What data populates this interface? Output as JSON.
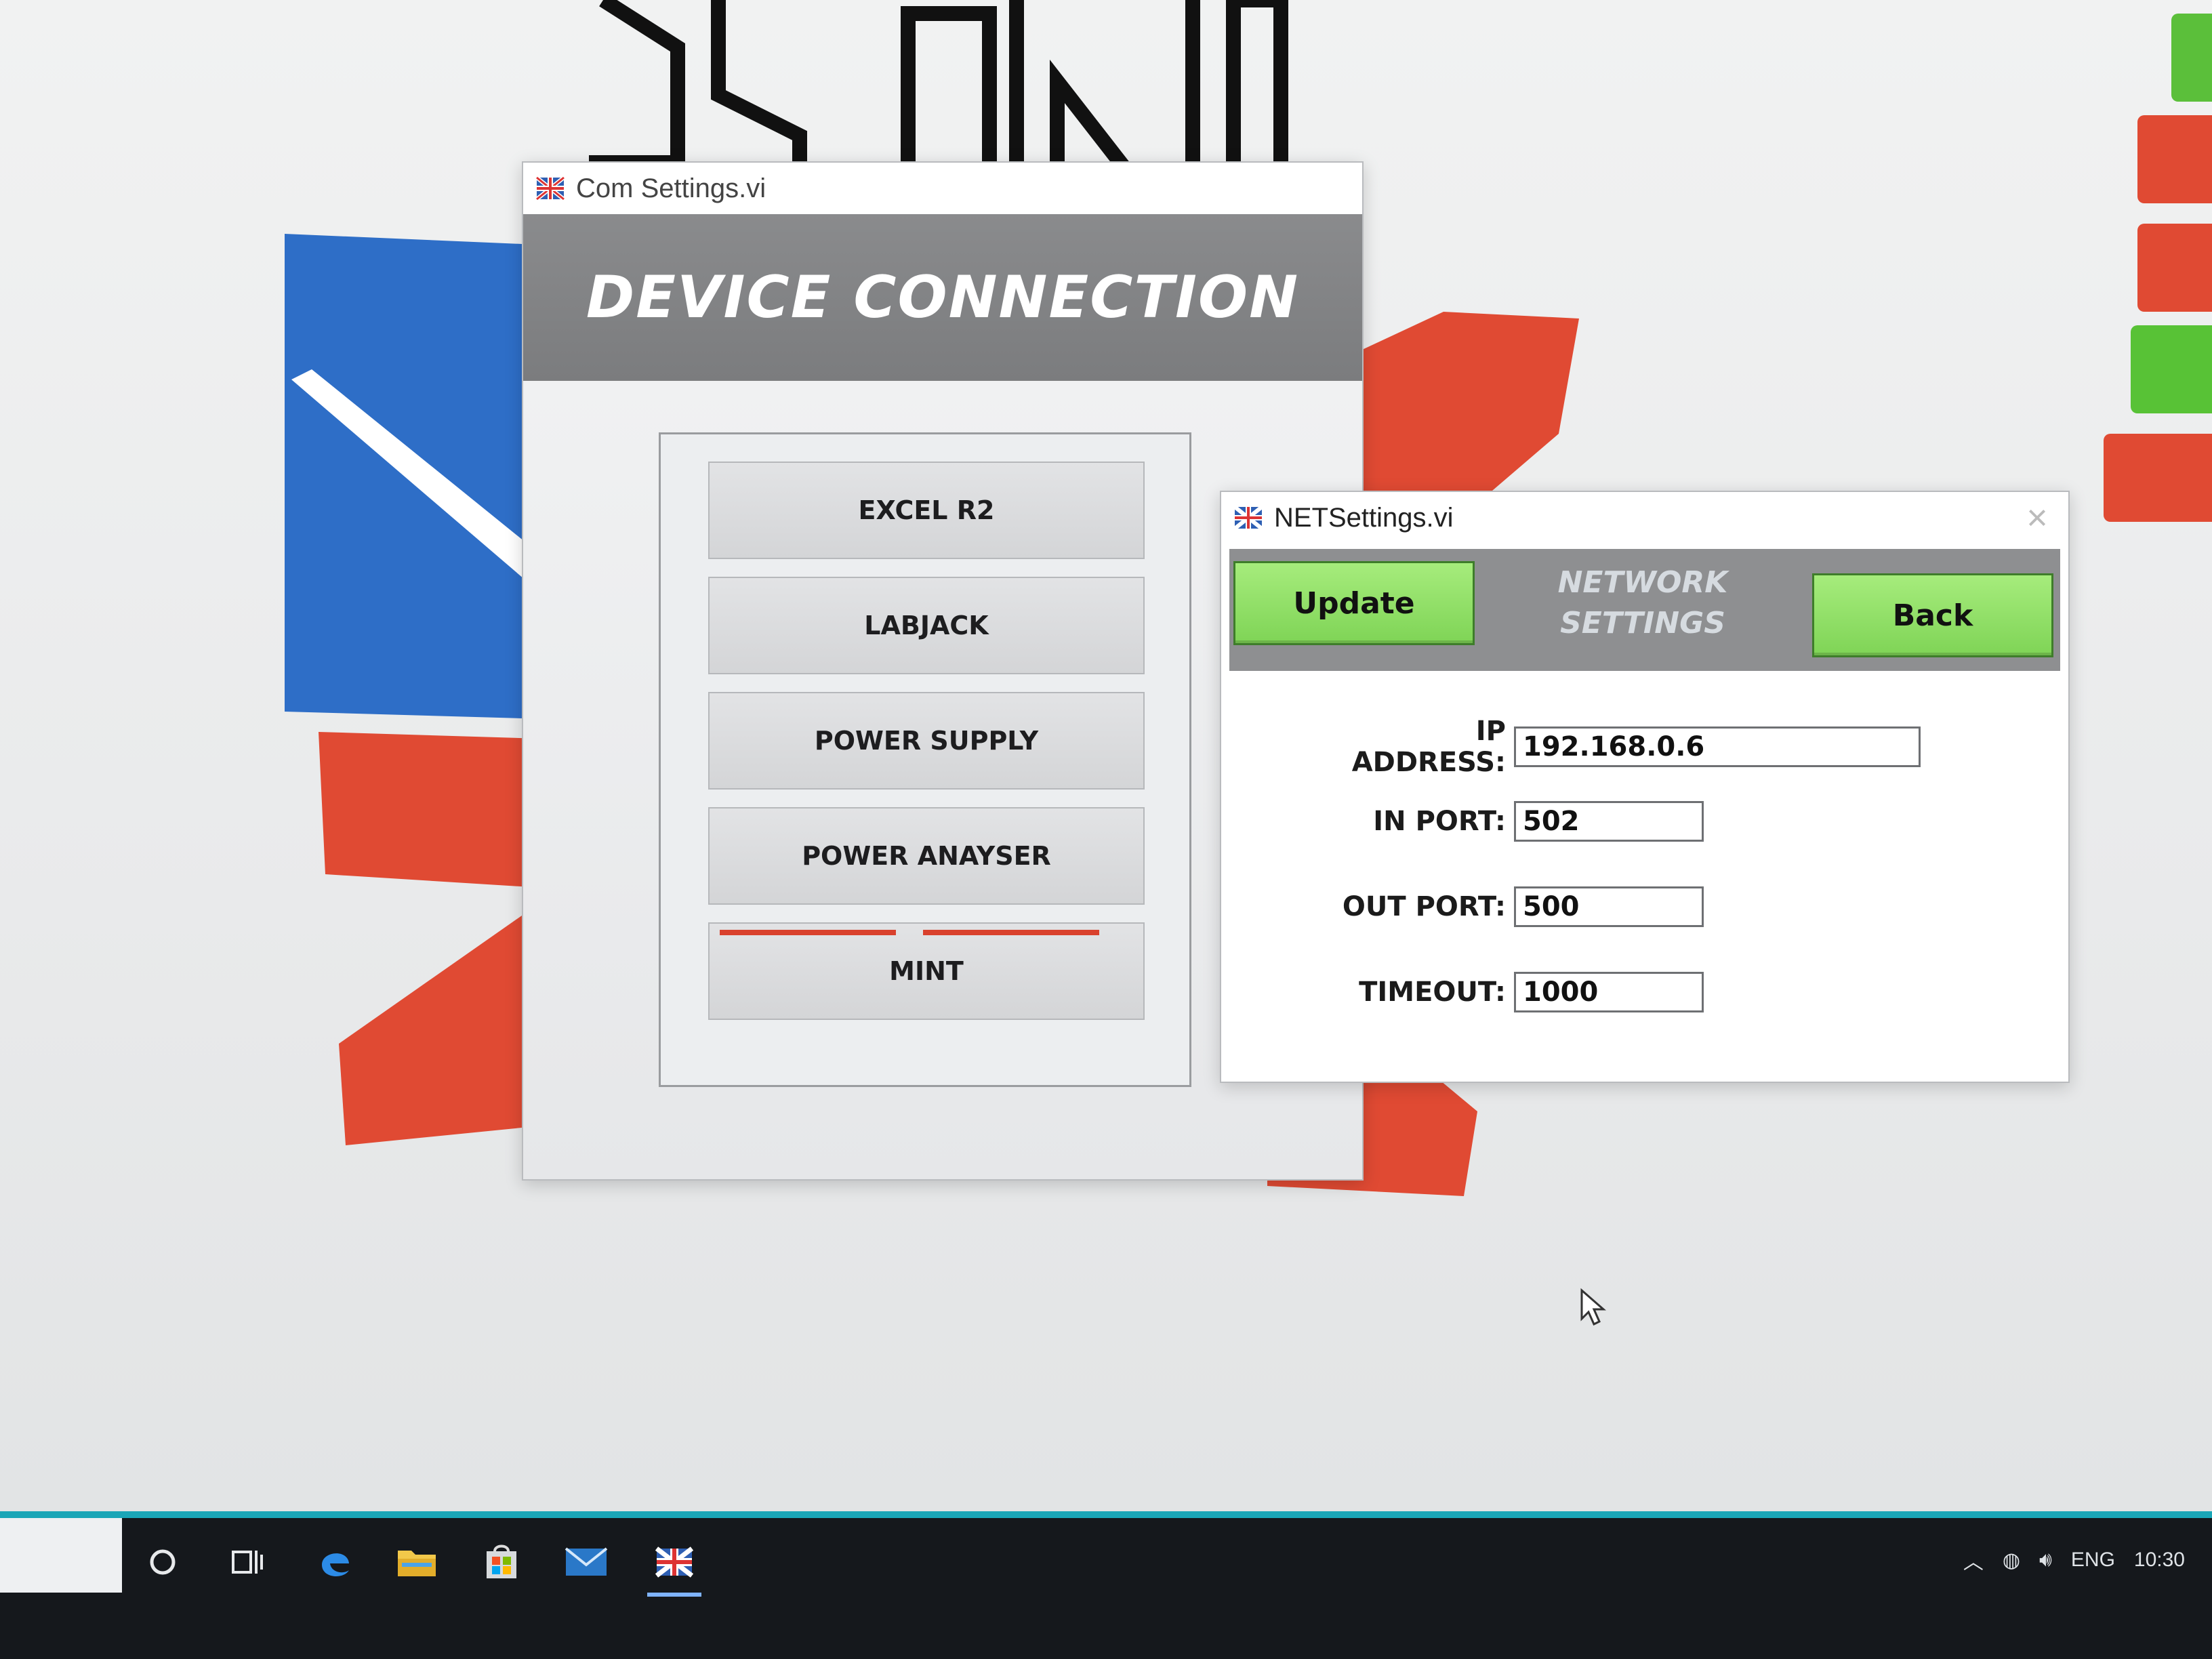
{
  "com_window": {
    "title": "Com Settings.vi",
    "header": "DEVICE CONNECTION",
    "buttons": [
      "EXCEL R2",
      "LABJACK",
      "POWER SUPPLY",
      "POWER ANAYSER",
      "MINT"
    ]
  },
  "net_window": {
    "title": "NETSettings.vi",
    "update_label": "Update",
    "back_label": "Back",
    "heading_line1": "NETWORK",
    "heading_line2": "SETTINGS",
    "fields": {
      "ip_label": "IP ADDRESS:",
      "ip_value": "192.168.0.6",
      "in_port_label": "IN PORT:",
      "in_port_value": "502",
      "out_port_label": "OUT PORT:",
      "out_port_value": "500",
      "timeout_label": "TIMEOUT:",
      "timeout_value": "1000"
    }
  },
  "taskbar": {
    "icons": [
      "search-icon",
      "task-view-icon",
      "edge-icon",
      "file-explorer-icon",
      "store-icon",
      "mail-icon",
      "app-flag-icon"
    ],
    "tray": {
      "language": "ENG",
      "time": "10:30"
    }
  },
  "colors": {
    "accent_green": "#8ede63",
    "header_grey": "#7f8082",
    "logo_red": "#e04a33",
    "logo_blue": "#2e6ec7"
  }
}
